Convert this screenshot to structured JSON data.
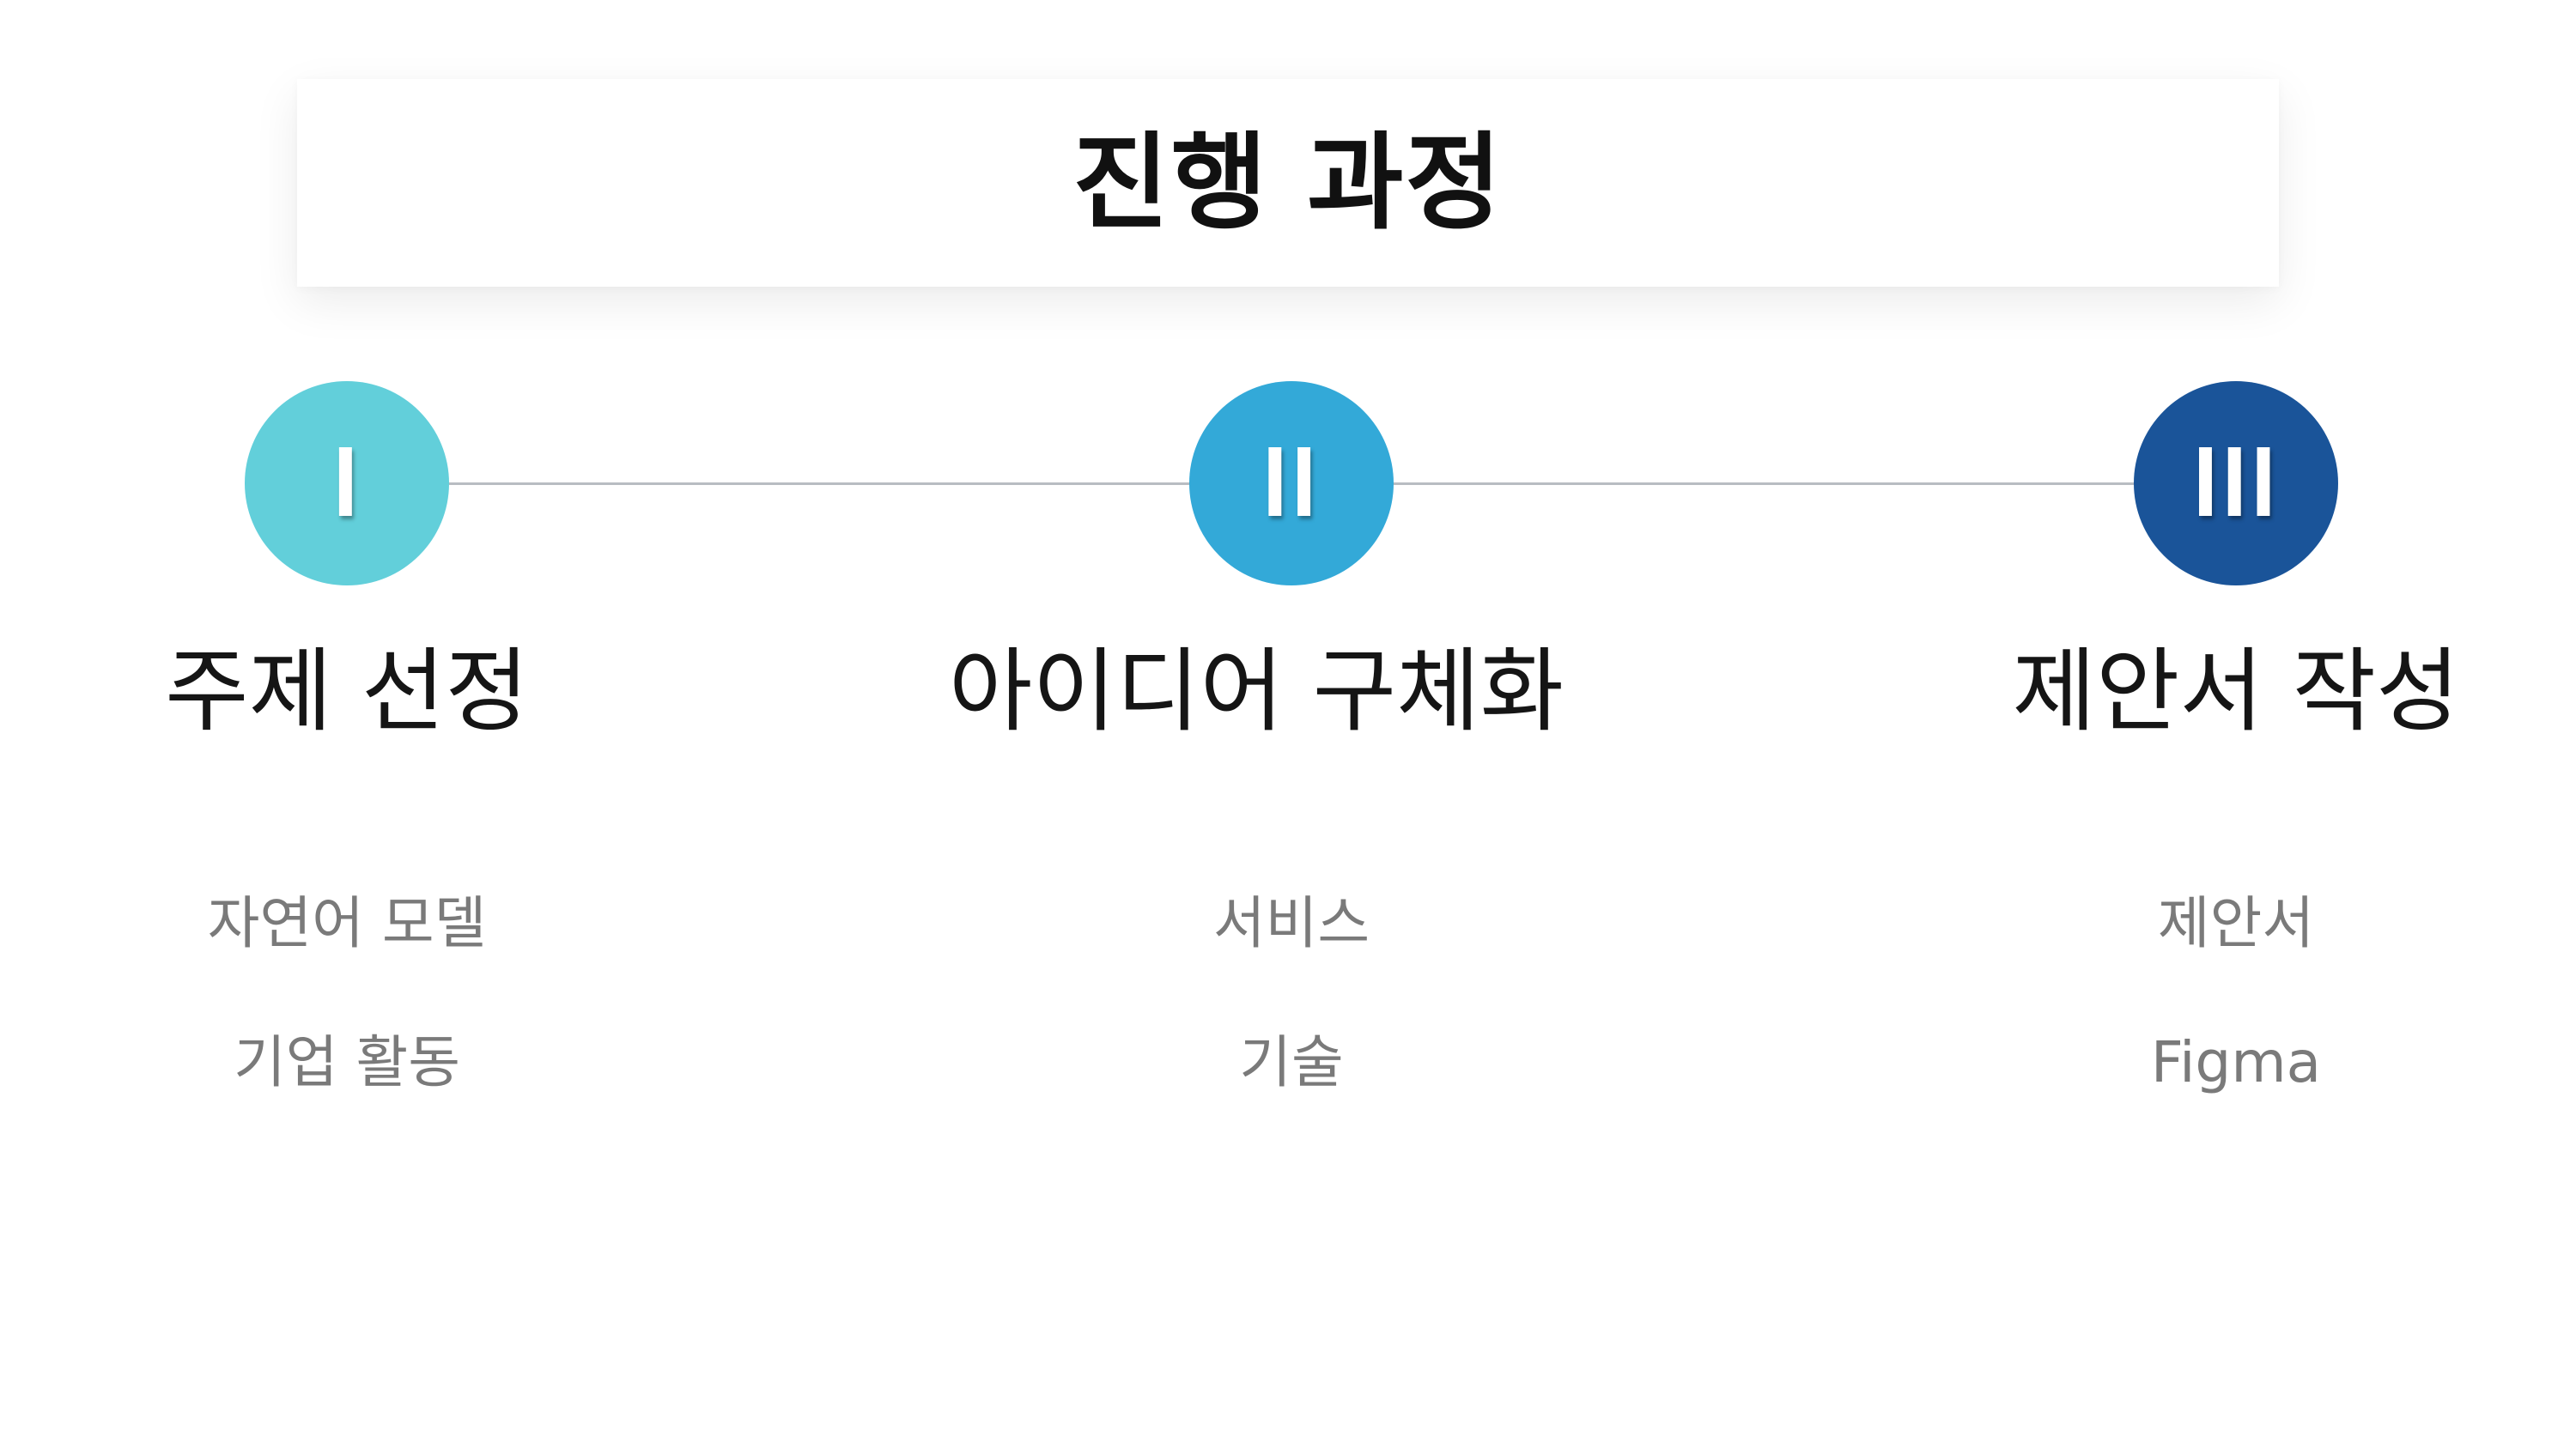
{
  "title": "진행 과정",
  "steps": [
    {
      "numeral": "I",
      "color": "#62cfda",
      "title": "주제 선정",
      "items": [
        "자연어 모델",
        "기업 활동"
      ]
    },
    {
      "numeral": "II",
      "color": "#33a9d8",
      "title": "아이디어 구체화",
      "items": [
        "서비스",
        "기술"
      ]
    },
    {
      "numeral": "III",
      "color": "#1a5499",
      "title": "제안서 작성",
      "items": [
        "제안서",
        "Figma"
      ]
    }
  ],
  "connector_color": "#b8bdc2"
}
